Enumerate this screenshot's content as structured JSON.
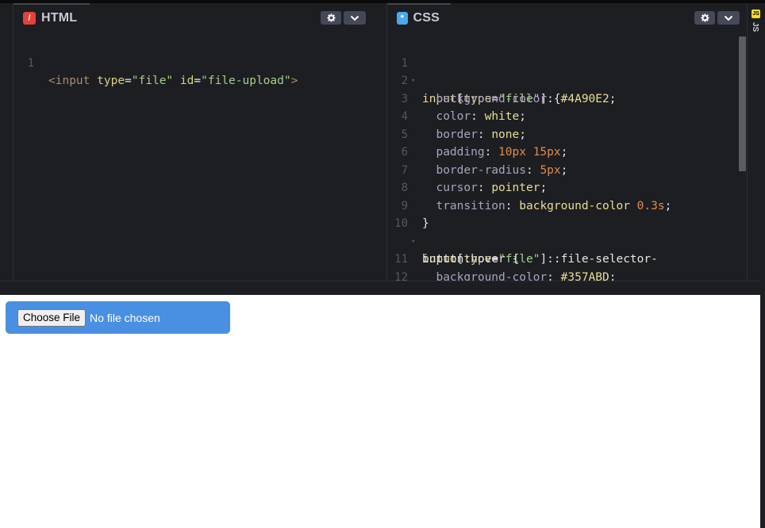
{
  "html_pane": {
    "title": "HTML",
    "badge": "/",
    "line_number": "1",
    "code": {
      "lt": "<",
      "tag": "input",
      "attr1": "type",
      "eq1": "=",
      "val1": "\"file\"",
      "attr2": "id",
      "eq2": "=",
      "val2": "\"file-upload\"",
      "gt": ">"
    }
  },
  "css_pane": {
    "title": "CSS",
    "badge": "*",
    "lines": [
      {
        "n": "1",
        "sel": "input",
        "open": "[",
        "attr": "type",
        "eq": "=",
        "str": "\"file\"",
        "close": "] {"
      },
      {
        "n": "2",
        "prop": "background-color",
        "colon": ": ",
        "val": "#4A90E2",
        "semi": ";"
      },
      {
        "n": "3",
        "prop": "color",
        "colon": ": ",
        "val": "white",
        "semi": ";"
      },
      {
        "n": "4",
        "prop": "border",
        "colon": ": ",
        "val": "none",
        "semi": ";"
      },
      {
        "n": "5",
        "prop": "padding",
        "colon": ": ",
        "num": "10px 15px",
        "semi": ";"
      },
      {
        "n": "6",
        "prop": "border-radius",
        "colon": ": ",
        "num": "5px",
        "semi": ";"
      },
      {
        "n": "7",
        "prop": "cursor",
        "colon": ": ",
        "val": "pointer",
        "semi": ";"
      },
      {
        "n": "8",
        "prop": "transition",
        "colon": ": ",
        "val": "background-color",
        "space": " ",
        "num": "0.3s",
        "semi": ";"
      },
      {
        "n": "9",
        "brace": "}"
      },
      {
        "n": "10",
        "sel": "input",
        "open": "[",
        "attr": "type",
        "eq": "=",
        "str": "\"file\"",
        "close": "]::file-selector-"
      },
      {
        "n": "",
        "cont": "button:hover {"
      },
      {
        "n": "11",
        "prop": "background-color",
        "colon": ": ",
        "val": "#357ABD",
        "semi": ";"
      },
      {
        "n": "12",
        "brace": "}"
      }
    ]
  },
  "js_pane": {
    "label": "JS",
    "badge": "JS"
  },
  "preview": {
    "choose_file_label": "Choose File",
    "file_status": "No file chosen",
    "input_bg": "#4A90E2"
  },
  "colors": {
    "editor_bg": "#1d1e22",
    "accent_html": "#e8413c",
    "accent_css": "#47a9ef",
    "accent_js": "#f7df1e"
  }
}
